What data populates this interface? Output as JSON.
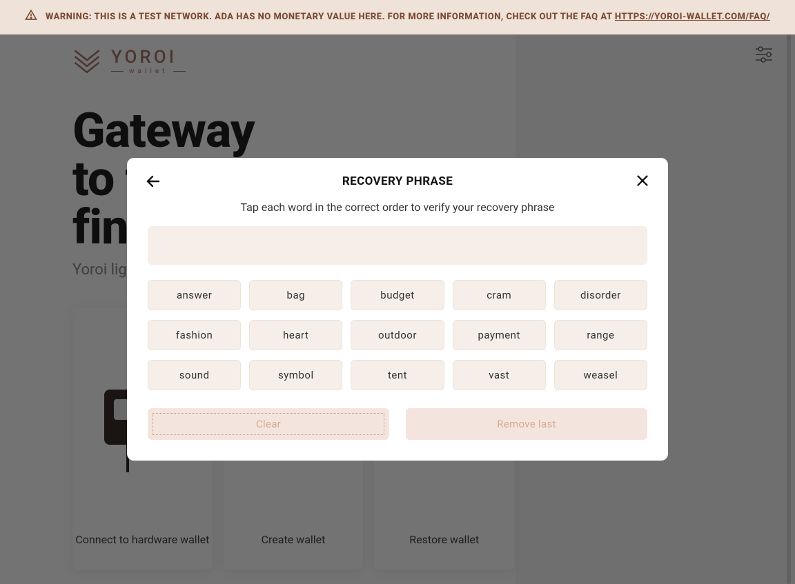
{
  "banner": {
    "text_prefix": "WARNING: THIS IS A TEST NETWORK. ADA HAS NO MONETARY VALUE HERE. FOR MORE INFORMATION, CHECK OUT THE FAQ AT ",
    "link_text": "HTTPS://YOROI-WALLET.COM/FAQ/"
  },
  "brand": {
    "name": "YOROI",
    "sub": "wallet"
  },
  "hero": {
    "line1": "Gateway",
    "line2": "to the",
    "line3": "financial world",
    "subtitle": "Yoroi light wallet for Cardano"
  },
  "cards": [
    {
      "caption": "Connect to hardware wallet"
    },
    {
      "caption": "Create wallet"
    },
    {
      "caption": "Restore wallet"
    }
  ],
  "modal": {
    "title": "RECOVERY PHRASE",
    "subtitle": "Tap each word in the correct order to verify your recovery phrase",
    "words": [
      "answer",
      "bag",
      "budget",
      "cram",
      "disorder",
      "fashion",
      "heart",
      "outdoor",
      "payment",
      "range",
      "sound",
      "symbol",
      "tent",
      "vast",
      "weasel"
    ],
    "clear_label": "Clear",
    "remove_label": "Remove last"
  },
  "colors": {
    "accent": "#a67b68",
    "word_bg": "#f6efe9",
    "action_bg": "#f3e5de"
  }
}
